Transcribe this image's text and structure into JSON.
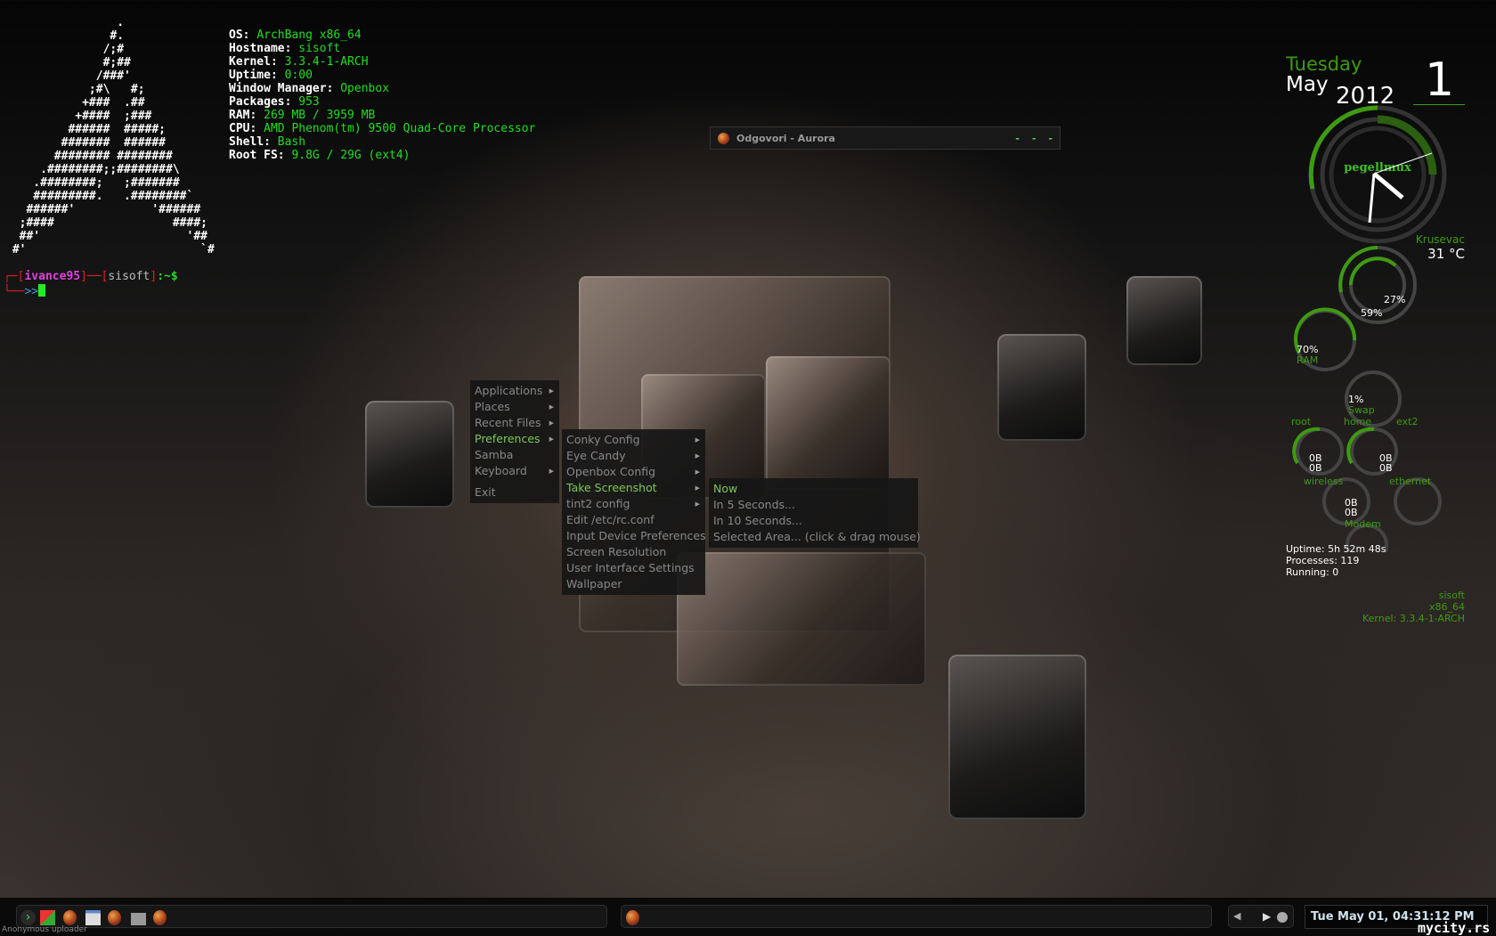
{
  "terminal": {
    "ascii_logo": [
      "                .",
      "               #.",
      "              /;#",
      "              #;##",
      "             /###'",
      "            ;#\\   #;",
      "           +###  .##",
      "          +####  ;###",
      "         ######  #####;",
      "        #######  ######",
      "       ######## ########",
      "     .########;;########\\",
      "    .########;   ;#######",
      "    #########.   .########`",
      "   ######'           '######",
      "  ;####                 ####;",
      "  ##'                     '##",
      " #'                         `#"
    ],
    "info": [
      {
        "key": "OS:",
        "value": "ArchBang x86_64"
      },
      {
        "key": "Hostname:",
        "value": "sisoft"
      },
      {
        "key": "Kernel:",
        "value": "3.3.4-1-ARCH"
      },
      {
        "key": "Uptime:",
        "value": "0:00"
      },
      {
        "key": "Window Manager:",
        "value": "Openbox"
      },
      {
        "key": "Packages:",
        "value": "953"
      },
      {
        "key": "RAM:",
        "value": "269 MB / 3959 MB"
      },
      {
        "key": "CPU:",
        "value": "AMD Phenom(tm) 9500 Quad-Core Processor"
      },
      {
        "key": "Shell:",
        "value": "Bash"
      },
      {
        "key": "Root FS:",
        "value": "9.8G / 29G (ext4)"
      }
    ],
    "prompt": {
      "user": "ivance95",
      "host": "sisoft",
      "path": ":~$",
      "arrow": ">>"
    }
  },
  "window": {
    "title": "Odgovori - Aurora",
    "buttons": [
      "-",
      "-",
      "-"
    ]
  },
  "menu": {
    "root": [
      {
        "label": "Applications",
        "sub": true
      },
      {
        "label": "Places",
        "sub": true
      },
      {
        "label": "Recent Files",
        "sub": true
      },
      {
        "label": "Preferences",
        "sub": true,
        "active": true
      },
      {
        "label": "Samba",
        "sub": false
      },
      {
        "label": "Keyboard",
        "sub": true
      },
      {
        "label": "Exit",
        "sub": false
      }
    ],
    "preferences": [
      {
        "label": "Conky Config",
        "sub": true
      },
      {
        "label": "Eye Candy",
        "sub": true
      },
      {
        "label": "Openbox Config",
        "sub": true
      },
      {
        "label": "Take Screenshot",
        "sub": true,
        "active": true
      },
      {
        "label": "tint2 config",
        "sub": true
      },
      {
        "label": "Edit /etc/rc.conf"
      },
      {
        "label": "Input Device Preferences"
      },
      {
        "label": "Screen Resolution"
      },
      {
        "label": "User Interface Settings"
      },
      {
        "label": "Wallpaper"
      }
    ],
    "screenshot": [
      {
        "label": "Now",
        "active": true
      },
      {
        "label": "In 5 Seconds..."
      },
      {
        "label": "In 10 Seconds..."
      },
      {
        "label": "Selected Area... (click & drag mouse)"
      }
    ]
  },
  "conky": {
    "weekday": "Tuesday",
    "month": "May",
    "year": "2012",
    "day": "1",
    "clock_logo": "pegellmux",
    "city": "Krusevac",
    "temp": "31 °C",
    "cpu1": "27%",
    "cpu2": "59%",
    "cpu1_value": 27,
    "cpu2_value": 59,
    "ram": "70%",
    "ram_label": "RAM",
    "ram_value": 70,
    "swap": "1%",
    "swap_label": "Swap",
    "fs_labels": [
      "root",
      "home",
      "ext2"
    ],
    "net": [
      {
        "label": "wireless",
        "up": "0B",
        "down": "0B"
      },
      {
        "label": "ethernet",
        "up": "0B",
        "down": "0B"
      },
      {
        "label": "Modem",
        "up": "0B",
        "down": "0B"
      }
    ],
    "uptime": "Uptime: 5h 52m 48s",
    "processes": "Processes: 119",
    "running": "Running: 0",
    "host": "sisoft",
    "arch": "x86_64",
    "kernel": "Kernel: 3.3.4-1-ARCH",
    "accent": "#3e9a12"
  },
  "taskbar": {
    "clock": "Tue May 01, 04:31:12 PM",
    "uploader": "Anonymous uploader",
    "watermark": "mycity.rs"
  }
}
